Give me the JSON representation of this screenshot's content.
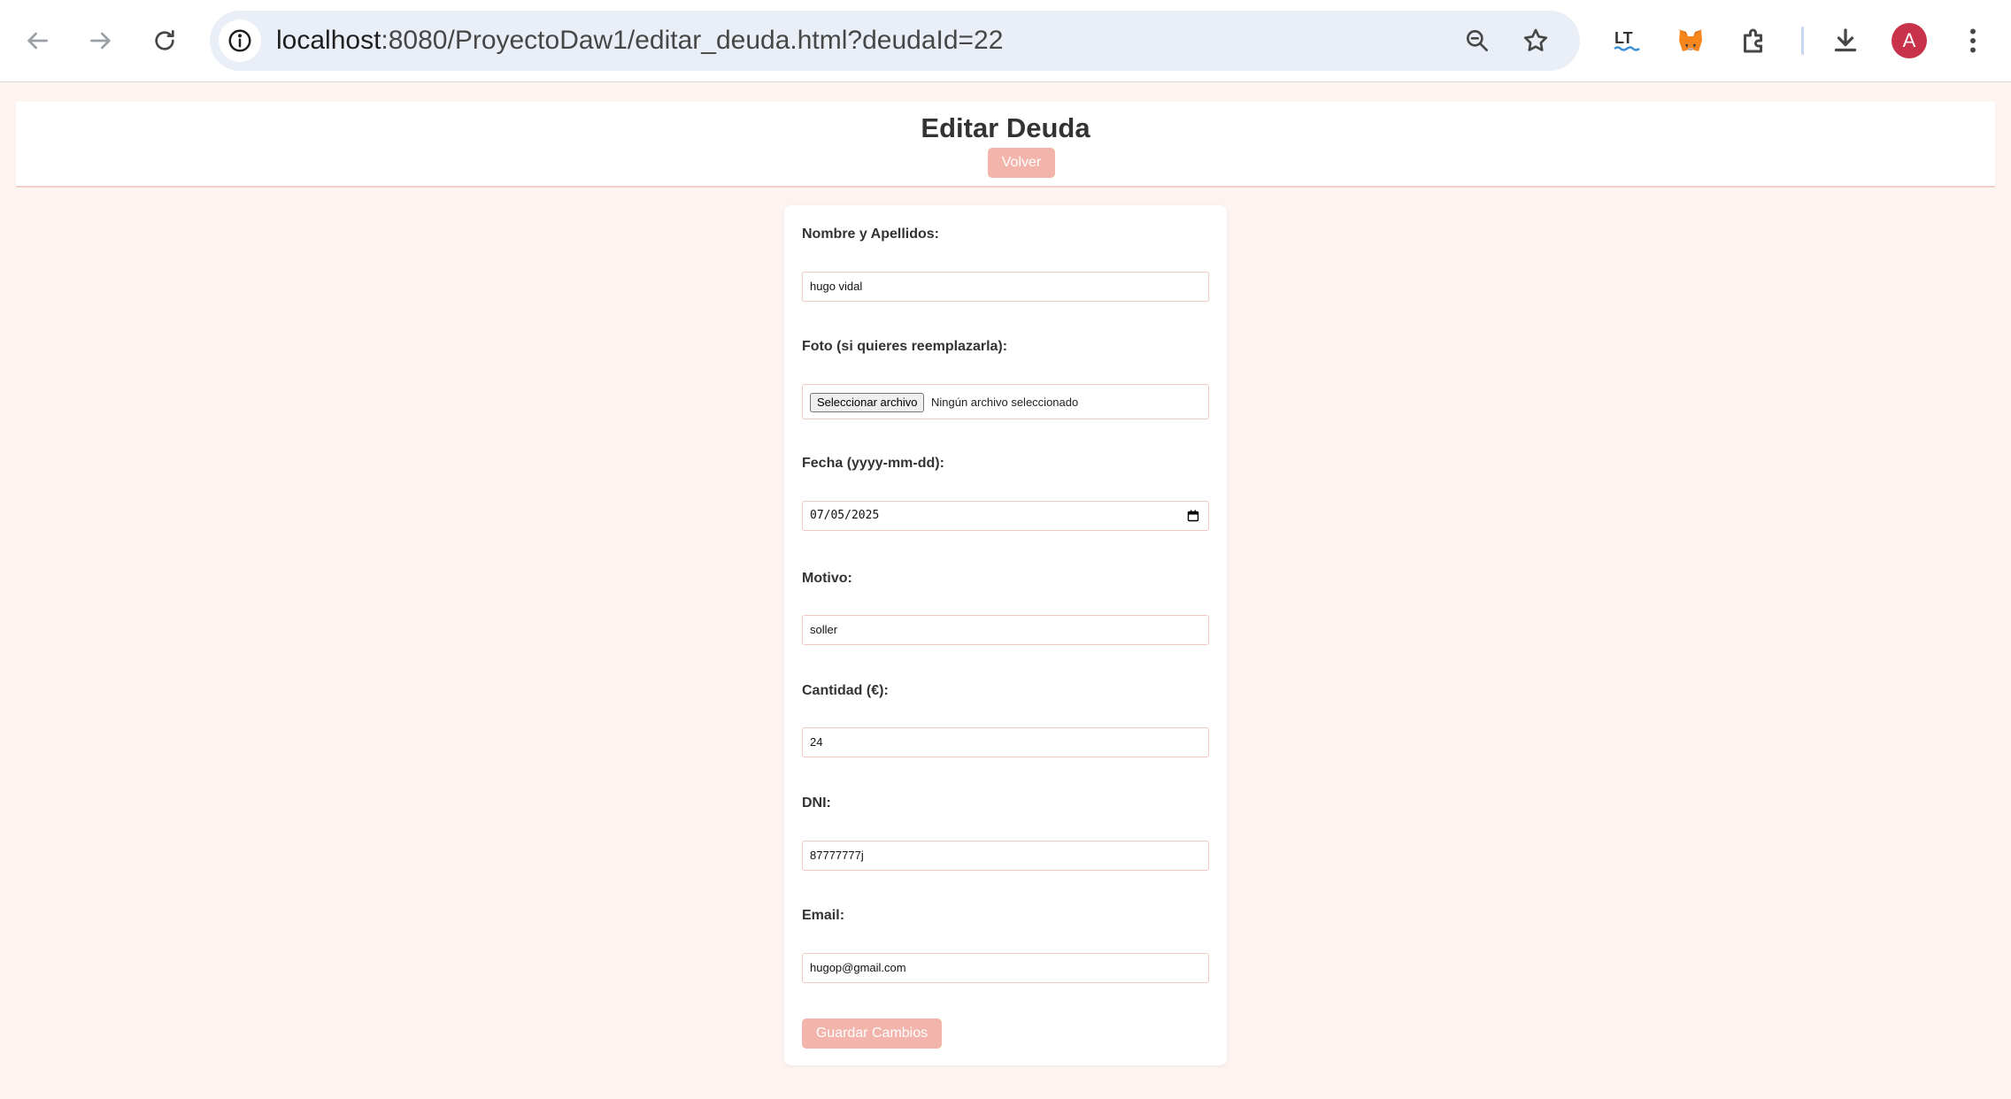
{
  "browser": {
    "url_host": "localhost",
    "url_path": ":8080/ProyectoDaw1/editar_deuda.html?deudaId=22",
    "avatar_letter": "A",
    "toolbar_icons": [
      "back-arrow-icon",
      "forward-arrow-icon",
      "reload-icon",
      "site-info-icon",
      "zoom-icon",
      "bookmark-star-icon",
      "languagetool-icon",
      "metamask-fox-icon",
      "extensions-puzzle-icon",
      "download-icon",
      "kebab-menu-icon"
    ]
  },
  "header": {
    "title": "Editar Deuda",
    "back_label": "Volver"
  },
  "form": {
    "name": {
      "label": "Nombre y Apellidos:",
      "value": "hugo vidal"
    },
    "photo": {
      "label": "Foto (si quieres reemplazarla):",
      "button_label": "Seleccionar archivo",
      "status": "Ningún archivo seleccionado"
    },
    "date": {
      "label": "Fecha (yyyy-mm-dd):",
      "value": "07/05/2025"
    },
    "reason": {
      "label": "Motivo:",
      "value": "soller"
    },
    "amount": {
      "label": "Cantidad (€):",
      "value": "24"
    },
    "dni": {
      "label": "DNI:",
      "value": "87777777j"
    },
    "email": {
      "label": "Email:",
      "value": "hugop@gmail.com"
    },
    "submit_label": "Guardar Cambios"
  },
  "colors": {
    "page_background": "#fdf3f1",
    "accent": "#f2b4ab",
    "input_border": "#f0c8c2",
    "avatar": "#c8334b"
  }
}
